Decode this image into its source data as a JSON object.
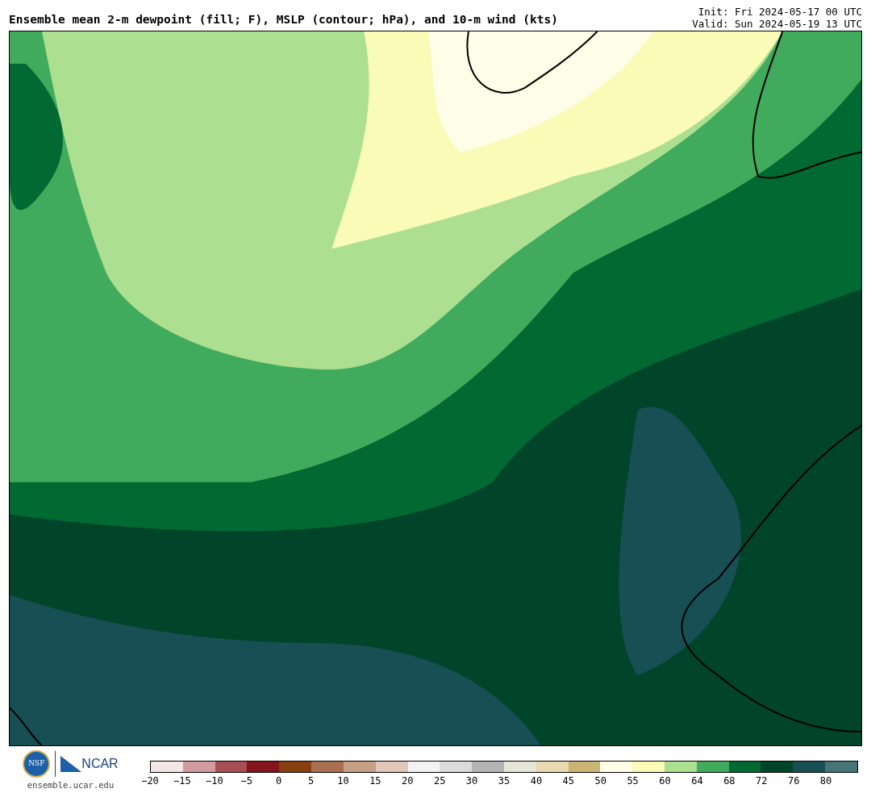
{
  "title": "Ensemble mean 2-m dewpoint (fill; F), MSLP (contour; hPa), and 10-m wind (kts)",
  "init": "Init: Fri 2024-05-17 00 UTC",
  "valid": "Valid: Sun 2024-05-19 13 UTC",
  "footer": {
    "logo_nsf": "NSF",
    "logo_ncar": "NCAR",
    "site": "ensemble.ucar.edu"
  },
  "colorbar": {
    "bins": [
      {
        "color": "#f3e6e6"
      },
      {
        "color": "#d19ba0"
      },
      {
        "color": "#a84f55"
      },
      {
        "color": "#86141c"
      },
      {
        "color": "#86400f"
      },
      {
        "color": "#a87050"
      },
      {
        "color": "#c59f86"
      },
      {
        "color": "#e2c7b8"
      },
      {
        "color": "#f3f3f3"
      },
      {
        "color": "#dcdcdc"
      },
      {
        "color": "#b4b4b4"
      },
      {
        "color": "#e5e5d8"
      },
      {
        "color": "#e8d9b0"
      },
      {
        "color": "#cbb574"
      },
      {
        "color": "#fefee8"
      },
      {
        "color": "#f9fbb7"
      },
      {
        "color": "#acdf8f"
      },
      {
        "color": "#41ab5d"
      },
      {
        "color": "#006a32"
      },
      {
        "color": "#00442a"
      },
      {
        "color": "#184f55"
      },
      {
        "color": "#467577"
      }
    ],
    "labels": [
      "−20",
      "−15",
      "−10",
      "−5",
      "0",
      "5",
      "10",
      "15",
      "20",
      "25",
      "30",
      "35",
      "40",
      "45",
      "50",
      "55",
      "60",
      "64",
      "68",
      "72",
      "76",
      "80"
    ]
  }
}
